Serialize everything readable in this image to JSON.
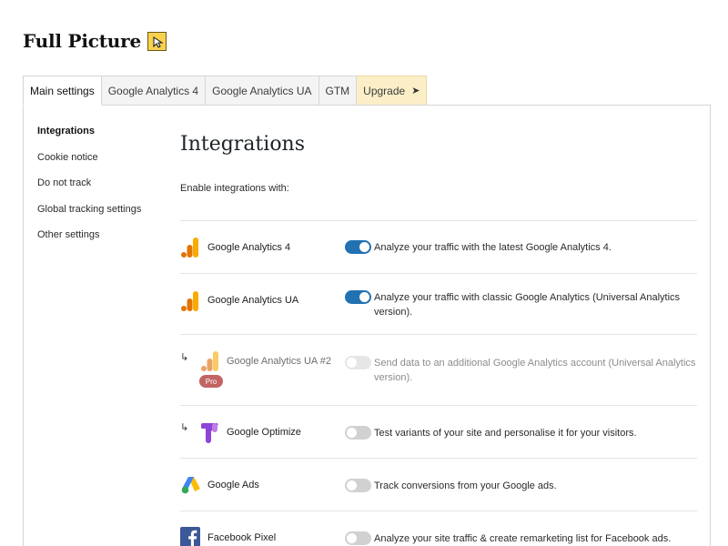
{
  "app": {
    "title": "Full Picture"
  },
  "tabs": [
    {
      "label": "Main settings"
    },
    {
      "label": "Google Analytics 4"
    },
    {
      "label": "Google Analytics UA"
    },
    {
      "label": "GTM"
    },
    {
      "label": "Upgrade"
    }
  ],
  "subnav": [
    {
      "label": "Integrations"
    },
    {
      "label": "Cookie notice"
    },
    {
      "label": "Do not track"
    },
    {
      "label": "Global tracking settings"
    },
    {
      "label": "Other settings"
    }
  ],
  "page": {
    "heading": "Integrations",
    "intro": "Enable integrations with:"
  },
  "integrations": [
    {
      "name": "Google Analytics 4",
      "icon": "google-analytics-icon",
      "enabled": true,
      "description": "Analyze your traffic with the latest Google Analytics 4."
    },
    {
      "name": "Google Analytics UA",
      "icon": "google-analytics-icon",
      "enabled": true,
      "description": "Analyze your traffic with classic Google Analytics (Universal Analytics version)."
    },
    {
      "name": "Google Analytics UA #2",
      "icon": "google-analytics-icon",
      "enabled": false,
      "disabled": true,
      "badge": "Pro",
      "description": "Send data to an additional Google Analytics account (Universal Analytics version)."
    },
    {
      "name": "Google Optimize",
      "icon": "google-optimize-icon",
      "enabled": false,
      "description": "Test variants of your site and personalise it for your visitors."
    },
    {
      "name": "Google Ads",
      "icon": "google-ads-icon",
      "enabled": false,
      "description": "Track conversions from your Google ads."
    },
    {
      "name": "Facebook Pixel",
      "icon": "facebook-icon",
      "enabled": false,
      "description": "Analyze your site traffic & create remarketing list for Facebook ads."
    }
  ],
  "colors": {
    "toggle_on": "#2271b1",
    "toggle_off": "#d1d1d1",
    "upgrade_tab": "#fcefc7",
    "logo": "#f8d24f",
    "pro_badge": "#c26464"
  }
}
